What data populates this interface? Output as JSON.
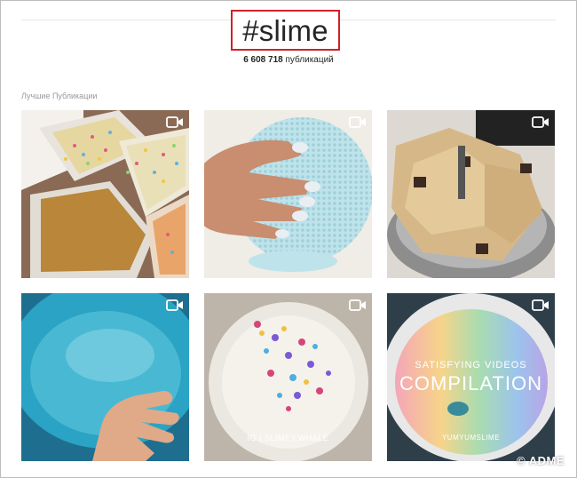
{
  "hashtag": {
    "title": "#slime",
    "count": "6 608 718",
    "count_suffix": "публикаций"
  },
  "section": {
    "label": "Лучшие Публикации"
  },
  "posts": [
    {
      "kind": "sprinkle-trays",
      "icon": "video-camera-icon"
    },
    {
      "kind": "textured-slime-hand",
      "icon": "video-camera-icon"
    },
    {
      "kind": "mixer-bowl",
      "icon": "video-camera-icon"
    },
    {
      "kind": "blue-water-bowl",
      "icon": "video-camera-icon"
    },
    {
      "kind": "confetti-slime",
      "icon": "video-camera-icon",
      "caption": "IG | SLIMEY.WHALE"
    },
    {
      "kind": "rainbow-bowl",
      "icon": "video-camera-icon",
      "caption_top": "SATISFYING VIDEOS",
      "caption_main": "COMPILATION",
      "caption_bottom": "YUMYUMSLIME"
    }
  ],
  "watermark": "© ADME",
  "colors": {
    "highlight": "#d0202a",
    "text": "#262626",
    "muted": "#999999"
  }
}
